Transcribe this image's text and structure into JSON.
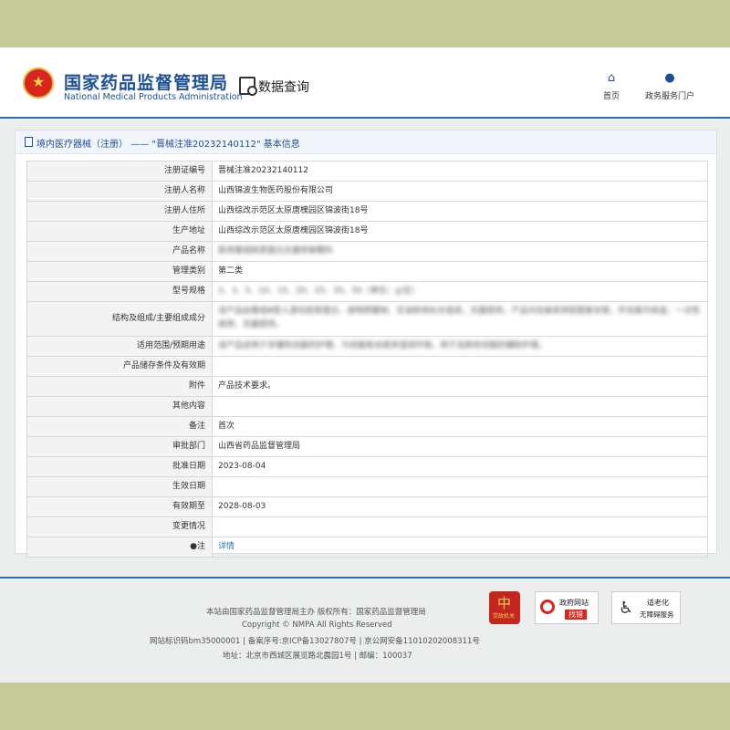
{
  "header": {
    "site_name_cn": "国家药品监督管理局",
    "site_name_en": "National Medical Products Administration",
    "page_section": "数据查询",
    "nav": [
      {
        "label": "首页",
        "icon": "home-icon"
      },
      {
        "label": "政务服务门户",
        "icon": "user-icon"
      }
    ]
  },
  "panel": {
    "title": "境内医疗器械（注册） —— \"晋械注准20232140112\" 基本信息"
  },
  "table": {
    "rows": [
      {
        "label": "注册证编号",
        "value": "晋械注准20232140112"
      },
      {
        "label": "注册人名称",
        "value": "山西锦波生物医药股份有限公司"
      },
      {
        "label": "注册人住所",
        "value": "山西综改示范区太原唐槐园区锦波街18号"
      },
      {
        "label": "生产地址",
        "value": "山西综改示范区太原唐槐园区锦波街18号"
      },
      {
        "label": "产品名称",
        "value": "医用重组胶原蛋白无菌修复敷料"
      },
      {
        "label": "管理类别",
        "value": "第二类"
      },
      {
        "label": "型号规格",
        "value": "2、3、5、10、15、20、25、30、50（单位：g/支）"
      },
      {
        "label": "结构及组成/主要组成成分",
        "value": "该产品由重组Ⅲ型人源化胶原蛋白、透明质酸钠、甘油和纯化水组成，无菌提供。产品内包装采用铝塑复合管，外包装为纸盒，一次性使用，无菌提供。"
      },
      {
        "label": "适用范围/预期用途",
        "value": "该产品适用于非慢性创面的护理，为创面愈合提供湿润环境，用于浅表性创面的辅助护理。"
      },
      {
        "label": "产品储存条件及有效期",
        "value": ""
      },
      {
        "label": "附件",
        "value": "产品技术要求。"
      },
      {
        "label": "其他内容",
        "value": ""
      },
      {
        "label": "备注",
        "value": "首次"
      },
      {
        "label": "审批部门",
        "value": "山西省药品监督管理局"
      },
      {
        "label": "批准日期",
        "value": "2023-08-04"
      },
      {
        "label": "生效日期",
        "value": ""
      },
      {
        "label": "有效期至",
        "value": "2028-08-03"
      },
      {
        "label": "变更情况",
        "value": ""
      },
      {
        "label": "●注",
        "value": "详情"
      }
    ]
  },
  "footer": {
    "line1": "本站由国家药品监督管理局主办 版权所有：国家药品监督管理局",
    "line2": "Copyright © NMPA All Rights Reserved",
    "line3": "网站标识码bm35000001 | 备案序号:京ICP备13027807号 | 京公网安备11010202008311号",
    "line4": "地址：北京市西城区展览路北露园1号 | 邮编：100037",
    "badges": {
      "party": "党政机关",
      "error_title": "政府网站",
      "error_action": "找错",
      "access_title": "适老化",
      "access_sub": "无障碍服务"
    }
  },
  "colors": {
    "brand_blue": "#1d4f97",
    "accent_line": "#2f6db0",
    "band": "#c6ca98"
  }
}
